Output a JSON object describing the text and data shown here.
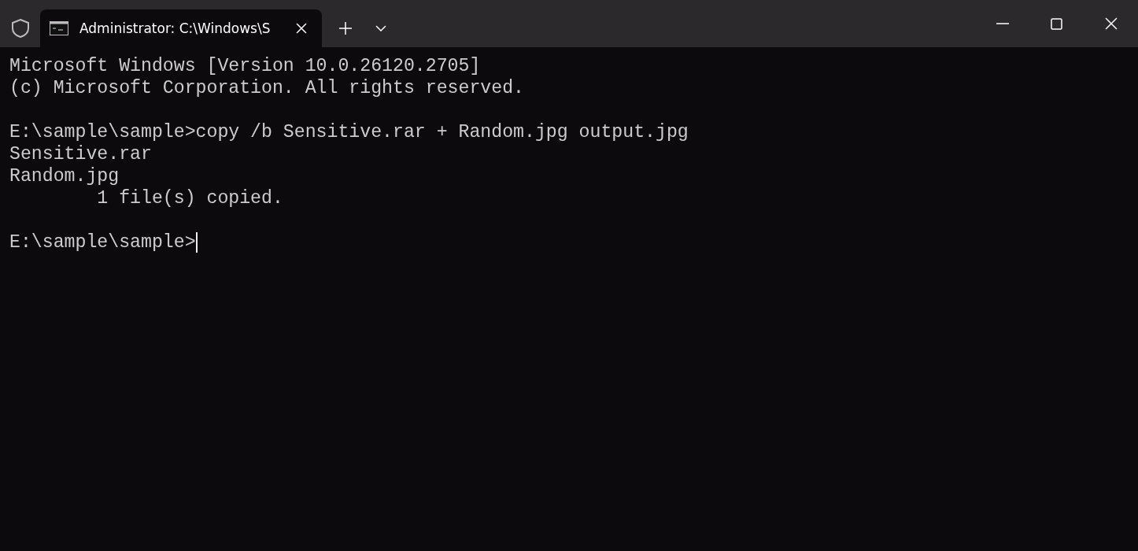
{
  "tabs": [
    {
      "title": "Administrator: C:\\Windows\\S",
      "selected": true
    }
  ],
  "console": {
    "blocks": [
      [
        "Microsoft Windows [Version 10.0.26120.2705]",
        "(c) Microsoft Corporation. All rights reserved."
      ],
      [
        "E:\\sample\\sample>copy /b Sensitive.rar + Random.jpg output.jpg",
        "Sensitive.rar",
        "Random.jpg",
        "        1 file(s) copied."
      ],
      [
        "E:\\sample\\sample>"
      ]
    ],
    "cursor": true
  }
}
